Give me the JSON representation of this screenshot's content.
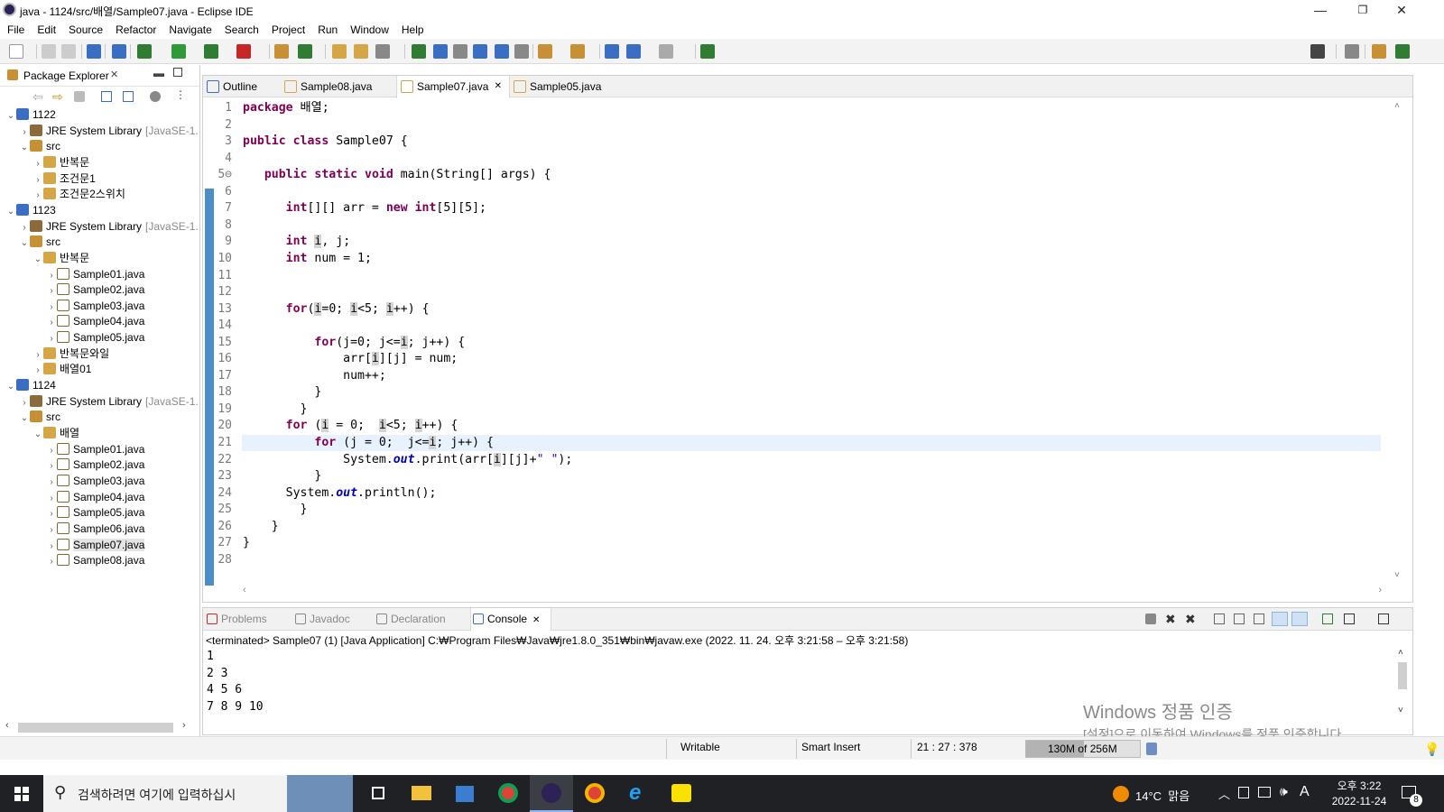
{
  "window": {
    "title": "java - 1124/src/배열/Sample07.java - Eclipse IDE",
    "min": "—",
    "max": "❐",
    "close": "✕"
  },
  "menu": [
    "File",
    "Edit",
    "Source",
    "Refactor",
    "Navigate",
    "Search",
    "Project",
    "Run",
    "Window",
    "Help"
  ],
  "package_explorer": {
    "title": "Package Explorer",
    "close": "✕",
    "tree": [
      {
        "text": "1122",
        "depth": 0,
        "icon": "proj",
        "tw": "v"
      },
      {
        "text": "JRE System Library",
        "suffix": "[JavaSE-1.",
        "depth": 1,
        "icon": "lib",
        "tw": ">"
      },
      {
        "text": "src",
        "depth": 1,
        "icon": "src",
        "tw": "v"
      },
      {
        "text": "반복문",
        "depth": 2,
        "icon": "pkg",
        "tw": ">"
      },
      {
        "text": "조건문1",
        "depth": 2,
        "icon": "pkg",
        "tw": ">"
      },
      {
        "text": "조건문2스위치",
        "depth": 2,
        "icon": "pkg",
        "tw": ">"
      },
      {
        "text": "1123",
        "depth": 0,
        "icon": "proj",
        "tw": "v"
      },
      {
        "text": "JRE System Library",
        "suffix": "[JavaSE-1.",
        "depth": 1,
        "icon": "lib",
        "tw": ">"
      },
      {
        "text": "src",
        "depth": 1,
        "icon": "src",
        "tw": "v"
      },
      {
        "text": "반복문",
        "depth": 2,
        "icon": "pkg",
        "tw": "v"
      },
      {
        "text": "Sample01.java",
        "depth": 3,
        "icon": "jfile",
        "tw": ">"
      },
      {
        "text": "Sample02.java",
        "depth": 3,
        "icon": "jfile",
        "tw": ">"
      },
      {
        "text": "Sample03.java",
        "depth": 3,
        "icon": "jfile",
        "tw": ">"
      },
      {
        "text": "Sample04.java",
        "depth": 3,
        "icon": "jfile",
        "tw": ">"
      },
      {
        "text": "Sample05.java",
        "depth": 3,
        "icon": "jfile",
        "tw": ">"
      },
      {
        "text": "반복문와일",
        "depth": 2,
        "icon": "pkg",
        "tw": ">"
      },
      {
        "text": "배열01",
        "depth": 2,
        "icon": "pkg",
        "tw": ">"
      },
      {
        "text": "1124",
        "depth": 0,
        "icon": "proj",
        "tw": "v"
      },
      {
        "text": "JRE System Library",
        "suffix": "[JavaSE-1.",
        "depth": 1,
        "icon": "lib",
        "tw": ">"
      },
      {
        "text": "src",
        "depth": 1,
        "icon": "src",
        "tw": "v"
      },
      {
        "text": "배열",
        "depth": 2,
        "icon": "pkg",
        "tw": "v"
      },
      {
        "text": "Sample01.java",
        "depth": 3,
        "icon": "jfile",
        "tw": ">"
      },
      {
        "text": "Sample02.java",
        "depth": 3,
        "icon": "jfile",
        "tw": ">"
      },
      {
        "text": "Sample03.java",
        "depth": 3,
        "icon": "jfile",
        "tw": ">"
      },
      {
        "text": "Sample04.java",
        "depth": 3,
        "icon": "jfile",
        "tw": ">"
      },
      {
        "text": "Sample05.java",
        "depth": 3,
        "icon": "jfile",
        "tw": ">"
      },
      {
        "text": "Sample06.java",
        "depth": 3,
        "icon": "jfile",
        "tw": ">"
      },
      {
        "text": "Sample07.java",
        "depth": 3,
        "icon": "jfile",
        "tw": ">",
        "selected": true
      },
      {
        "text": "Sample08.java",
        "depth": 3,
        "icon": "jfile",
        "tw": ">"
      }
    ]
  },
  "editor": {
    "tabs": [
      {
        "label": "Outline",
        "active": false
      },
      {
        "label": "Sample08.java",
        "active": false
      },
      {
        "label": "Sample07.java",
        "active": true,
        "close": "✕"
      },
      {
        "label": "Sample05.java",
        "active": false
      }
    ],
    "current_line": 21,
    "lines": [
      {
        "n": "1",
        "html": "<span class='kw'>package</span> 배열;"
      },
      {
        "n": "2",
        "html": ""
      },
      {
        "n": "3",
        "html": "<span class='kw'>public</span> <span class='kw'>class</span> Sample07 {"
      },
      {
        "n": "4",
        "html": ""
      },
      {
        "n": "5⊖",
        "html": "   <span class='kw'>public</span> <span class='kw'>static</span> <span class='kw'>void</span> main(String[] args) {"
      },
      {
        "n": "6",
        "html": ""
      },
      {
        "n": "7",
        "html": "      <span class='kw'>int</span>[][] arr = <span class='kw'>new</span> <span class='kw'>int</span>[5][5];"
      },
      {
        "n": "8",
        "html": ""
      },
      {
        "n": "9",
        "html": "      <span class='kw'>int</span> <span class='hl'>i</span>, j;"
      },
      {
        "n": "10",
        "html": "      <span class='kw'>int</span> num = 1;"
      },
      {
        "n": "11",
        "html": ""
      },
      {
        "n": "12",
        "html": ""
      },
      {
        "n": "13",
        "html": "      <span class='kw'>for</span>(<span class='hl'>i</span>=0; <span class='hl'>i</span>&lt;5; <span class='hl'>i</span>++) {"
      },
      {
        "n": "14",
        "html": ""
      },
      {
        "n": "15",
        "html": "          <span class='kw'>for</span>(j=0; j&lt;=<span class='hl'>i</span>; j++) {"
      },
      {
        "n": "16",
        "html": "              arr[<span class='hl'>i</span>][j] = num;"
      },
      {
        "n": "17",
        "html": "              num++;"
      },
      {
        "n": "18",
        "html": "          }"
      },
      {
        "n": "19",
        "html": "        }"
      },
      {
        "n": "20",
        "html": "      <span class='kw'>for</span> (<span class='hl'>i</span> = 0;  <span class='hl'>i</span>&lt;5; <span class='hl'>i</span>++) {"
      },
      {
        "n": "21",
        "html": "          <span class='kw'>for</span> (j = 0;  j&lt;=<span class='hl'>i</span>; j++) {"
      },
      {
        "n": "22",
        "html": "              System.<span class='fd'>out</span>.print(arr[<span class='hl'>i</span>][j]+<span class='st'>\" \"</span>);"
      },
      {
        "n": "23",
        "html": "          }"
      },
      {
        "n": "24",
        "html": "      System.<span class='fd'>out</span>.println();"
      },
      {
        "n": "25",
        "html": "        }"
      },
      {
        "n": "26",
        "html": "    }"
      },
      {
        "n": "27",
        "html": "}"
      },
      {
        "n": "28",
        "html": ""
      }
    ]
  },
  "console": {
    "tabs": [
      {
        "label": "Problems",
        "active": false
      },
      {
        "label": "Javadoc",
        "active": false
      },
      {
        "label": "Declaration",
        "active": false
      },
      {
        "label": "Console",
        "active": true,
        "close": "✕"
      }
    ],
    "header": "<terminated> Sample07 (1) [Java Application] C:₩Program Files₩Java₩jre1.8.0_351₩bin₩javaw.exe  (2022. 11. 24. 오후 3:21:58 – 오후 3:21:58)",
    "output": [
      "1",
      "2 3",
      "4 5 6",
      "7 8 9 10"
    ]
  },
  "watermark": {
    "line1": "Windows 정품 인증",
    "line2": "[설정]으로 이동하여 Windows를 정품 인증합니다."
  },
  "status": {
    "writable": "Writable",
    "insert": "Smart Insert",
    "position": "21 : 27 : 378",
    "heap": "130M of 256M",
    "heap_fraction": 0.51
  },
  "taskbar": {
    "search_placeholder": "검색하려면 여기에 입력하십시",
    "weather": "14°C  맑음",
    "time": "오후 3:22",
    "date": "2022-11-24",
    "notifications": "8",
    "ime": "A"
  }
}
